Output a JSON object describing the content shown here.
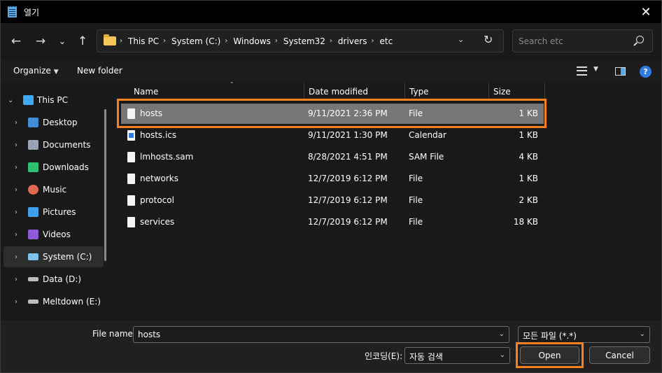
{
  "window": {
    "title": "열기",
    "close_glyph": "✕"
  },
  "nav": {
    "back": "←",
    "forward": "→",
    "recent": "⌄",
    "up": "↑"
  },
  "address": {
    "crumbs": [
      "This PC",
      "System (C:)",
      "Windows",
      "System32",
      "drivers",
      "etc"
    ],
    "separator": "›",
    "dropdown": "⌄",
    "refresh": "↻"
  },
  "search": {
    "placeholder": "Search etc"
  },
  "toolbar": {
    "organize": "Organize",
    "organize_caret": "▼",
    "new_folder": "New folder",
    "view_caret": "▼",
    "help": "?"
  },
  "sidebar": {
    "items": [
      {
        "label": "This PC",
        "icon": "monitor-icon",
        "color": "#3fa9f5",
        "expanded": true
      },
      {
        "label": "Desktop",
        "icon": "desktop-icon",
        "color": "#3f8fd8"
      },
      {
        "label": "Documents",
        "icon": "documents-icon",
        "color": "#9aa3b5"
      },
      {
        "label": "Downloads",
        "icon": "download-icon",
        "color": "#2fbf71"
      },
      {
        "label": "Music",
        "icon": "music-icon",
        "color": "#e0694f"
      },
      {
        "label": "Pictures",
        "icon": "pictures-icon",
        "color": "#3f9fe8"
      },
      {
        "label": "Videos",
        "icon": "videos-icon",
        "color": "#8e5ad6"
      },
      {
        "label": "System (C:)",
        "icon": "drive-icon",
        "color": "#7fc4e8",
        "selected": true
      },
      {
        "label": "Data (D:)",
        "icon": "drive-icon",
        "color": "#bdbdbd"
      },
      {
        "label": "Meltdown (E:)",
        "icon": "drive-icon",
        "color": "#bdbdbd"
      }
    ],
    "chevron_expanded": "⌄",
    "chevron_collapsed": "›"
  },
  "columns": {
    "name": "Name",
    "date": "Date modified",
    "type": "Type",
    "size": "Size",
    "sort_glyph": "⌃"
  },
  "files": [
    {
      "name": "hosts",
      "date": "9/11/2021 2:36 PM",
      "type": "File",
      "size": "1 KB",
      "icon": "file-icon",
      "selected": true
    },
    {
      "name": "hosts.ics",
      "date": "9/11/2021 1:30 PM",
      "type": "Calendar",
      "size": "1 KB",
      "icon": "calendar-file-icon"
    },
    {
      "name": "lmhosts.sam",
      "date": "8/28/2021 4:51 PM",
      "type": "SAM File",
      "size": "4 KB",
      "icon": "file-icon"
    },
    {
      "name": "networks",
      "date": "12/7/2019 6:12 PM",
      "type": "File",
      "size": "1 KB",
      "icon": "file-icon"
    },
    {
      "name": "protocol",
      "date": "12/7/2019 6:12 PM",
      "type": "File",
      "size": "2 KB",
      "icon": "file-icon"
    },
    {
      "name": "services",
      "date": "12/7/2019 6:12 PM",
      "type": "File",
      "size": "18 KB",
      "icon": "file-icon"
    }
  ],
  "footer": {
    "filename_label": "File name:",
    "filename_value": "hosts",
    "filter_value": "모든 파일 (*.*)",
    "encoding_label": "인코딩(E):",
    "encoding_value": "자동 검색",
    "dropdown_glyph": "⌄",
    "open": "Open",
    "cancel": "Cancel"
  },
  "colors": {
    "highlight": "#f7801f",
    "selection": "#777777",
    "accent": "#2f7ae5"
  }
}
